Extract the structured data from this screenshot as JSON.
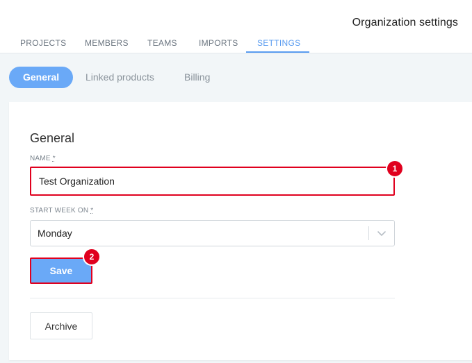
{
  "header": {
    "title": "Organization settings",
    "tabs": [
      {
        "label": "PROJECTS"
      },
      {
        "label": "MEMBERS"
      },
      {
        "label": "TEAMS"
      },
      {
        "label": "IMPORTS"
      },
      {
        "label": "SETTINGS"
      }
    ],
    "active_tab": "SETTINGS"
  },
  "subtabs": [
    {
      "label": "General"
    },
    {
      "label": "Linked products"
    },
    {
      "label": "Billing"
    }
  ],
  "active_subtab": "General",
  "form": {
    "section_title": "General",
    "name_label": "NAME",
    "name_required": "*",
    "name_value": "Test Organization",
    "start_week_label": "START WEEK ON",
    "start_week_required": "*",
    "start_week_value": "Monday",
    "save_label": "Save",
    "archive_label": "Archive"
  },
  "annotations": [
    {
      "label": "1"
    },
    {
      "label": "2"
    }
  ],
  "colors": {
    "accent": "#5a9cf0",
    "button_primary": "#6aa9f7",
    "highlight": "#e0001e"
  },
  "icons": {
    "select_arrow": "chevron-down-icon"
  }
}
